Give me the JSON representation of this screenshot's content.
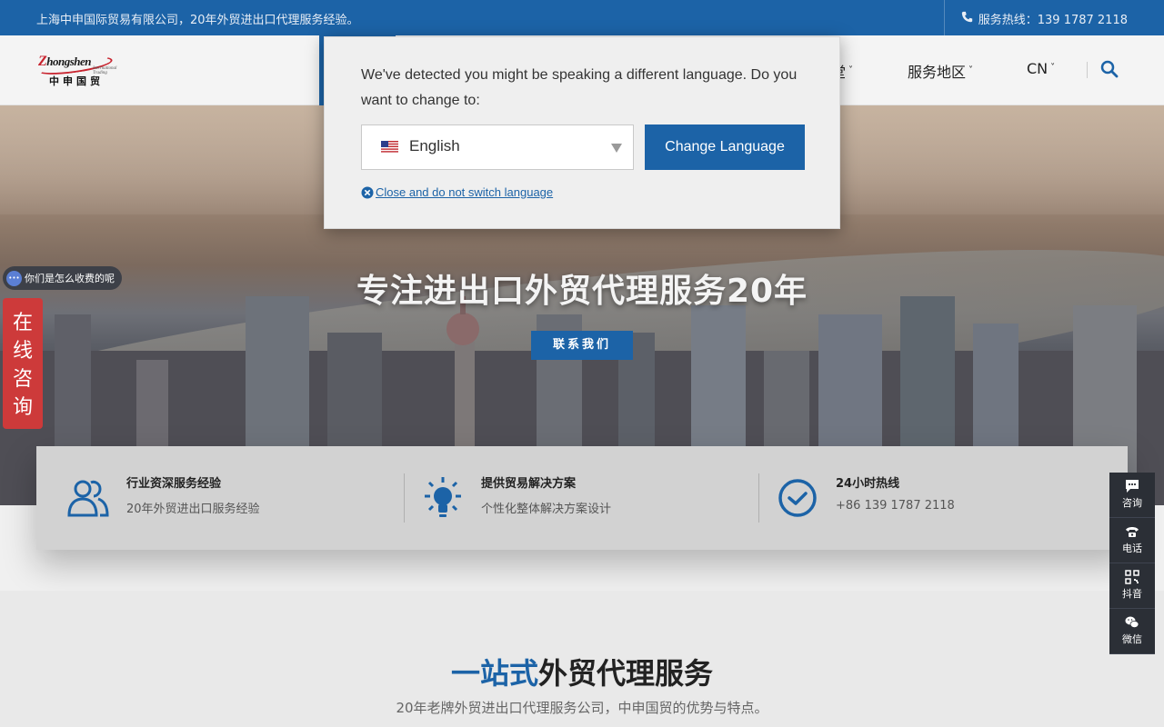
{
  "topbar": {
    "company": "上海中申国际贸易有限公司，20年外贸进出口代理服务经验。",
    "hotline": "服务热线：139 1787 2118"
  },
  "logo": {
    "brand_z": "Z",
    "brand_rest": "hongshen",
    "tagline": "International Trading",
    "cn": "中申国贸"
  },
  "nav": {
    "items": [
      {
        "label": "堂"
      },
      {
        "label": "服务地区"
      },
      {
        "label": "CN"
      }
    ],
    "chevron": "˅"
  },
  "hero": {
    "title": "专注进出口外贸代理服务20年",
    "button": "联系我们"
  },
  "left_widgets": {
    "fee_chip": "你们是怎么收费的呢",
    "fee_chip_icon": "chat-dots-icon",
    "consult_tab": [
      "在",
      "线",
      "咨",
      "询"
    ]
  },
  "features": [
    {
      "title": "行业资深服务经验",
      "desc": "20年外贸进出口服务经验",
      "icon": "users-icon"
    },
    {
      "title": "提供贸易解决方案",
      "desc": "个性化整体解决方案设计",
      "icon": "lightbulb-icon"
    },
    {
      "title": "24小时热线",
      "desc": "+86 139 1787 2118",
      "icon": "clock-icon"
    }
  ],
  "side_bar": [
    {
      "label": "咨询",
      "icon": "chat-icon"
    },
    {
      "label": "电话",
      "icon": "phone-icon"
    },
    {
      "label": "抖音",
      "icon": "qrcode-icon"
    },
    {
      "label": "微信",
      "icon": "wechat-icon"
    }
  ],
  "section": {
    "title_accent": "一站式",
    "title_rest": "外贸代理服务",
    "subtitle": "20年老牌外贸进出口代理服务公司，中申国贸的优势与特点。"
  },
  "language_modal": {
    "message": "We've detected you might be speaking a different language. Do you want to change to:",
    "selected_language": "English",
    "change_button": "Change Language",
    "close_link": "Close and do not switch language"
  },
  "colors": {
    "brand_blue": "#1c63a7",
    "consult_red": "#cd3a3a",
    "side_bar_dark": "#2b2f36"
  }
}
